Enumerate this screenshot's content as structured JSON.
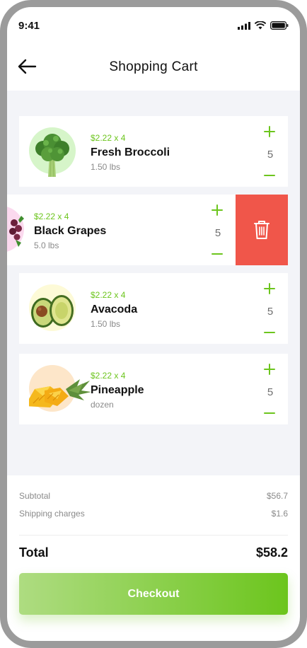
{
  "status_bar": {
    "time": "9:41",
    "icons": [
      "signal-icon",
      "wifi-icon",
      "battery-icon"
    ]
  },
  "header": {
    "title": "Shopping Cart",
    "back_icon": "arrow-left-icon"
  },
  "cart_items": [
    {
      "price": "$2.22 x 4",
      "name": "Fresh Broccoli",
      "weight": "1.50 lbs",
      "quantity": "5",
      "thumb_bg": "#d6f5c9",
      "icon": "broccoli-icon"
    },
    {
      "price": "$2.22 x 4",
      "name": "Black Grapes",
      "weight": "5.0 lbs",
      "quantity": "5",
      "thumb_bg": "#fbd9ee",
      "icon": "grapes-icon",
      "swiped": true
    },
    {
      "price": "$2.22 x 4",
      "name": "Avacoda",
      "weight": "1.50 lbs",
      "quantity": "5",
      "thumb_bg": "#fdfad7",
      "icon": "avocado-icon"
    },
    {
      "price": "$2.22 x 4",
      "name": "Pineapple",
      "weight": "dozen",
      "quantity": "5",
      "thumb_bg": "#fde6c9",
      "icon": "pineapple-icon"
    }
  ],
  "delete_action": {
    "icon": "trash-icon",
    "color": "#f0564a"
  },
  "summary": {
    "subtotal_label": "Subtotal",
    "subtotal_value": "$56.7",
    "shipping_label": "Shipping charges",
    "shipping_value": "$1.6",
    "total_label": "Total",
    "total_value": "$58.2"
  },
  "checkout": {
    "label": "Checkout"
  },
  "colors": {
    "accent": "#6cc51d",
    "accent_light": "#aedc81",
    "background": "#f3f4f8",
    "delete": "#f0564a"
  }
}
